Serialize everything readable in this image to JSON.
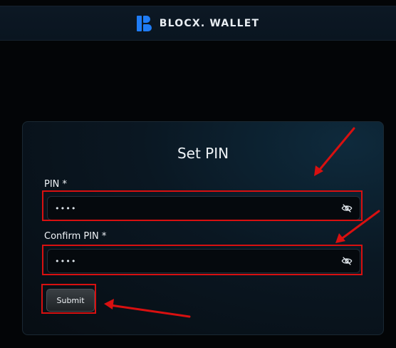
{
  "header": {
    "brand": "BLOCX. WALLET",
    "logo_icon": "blocx-logo-icon",
    "accent": "#1f7cf5"
  },
  "form": {
    "title": "Set PIN",
    "pin": {
      "label": "PIN *",
      "value": "••••",
      "placeholder": ""
    },
    "confirm_pin": {
      "label": "Confirm PIN *",
      "value": "••••",
      "placeholder": ""
    },
    "toggle_icon": "eye-off-icon",
    "submit_label": "Submit"
  },
  "annotation_color": "#d81010"
}
